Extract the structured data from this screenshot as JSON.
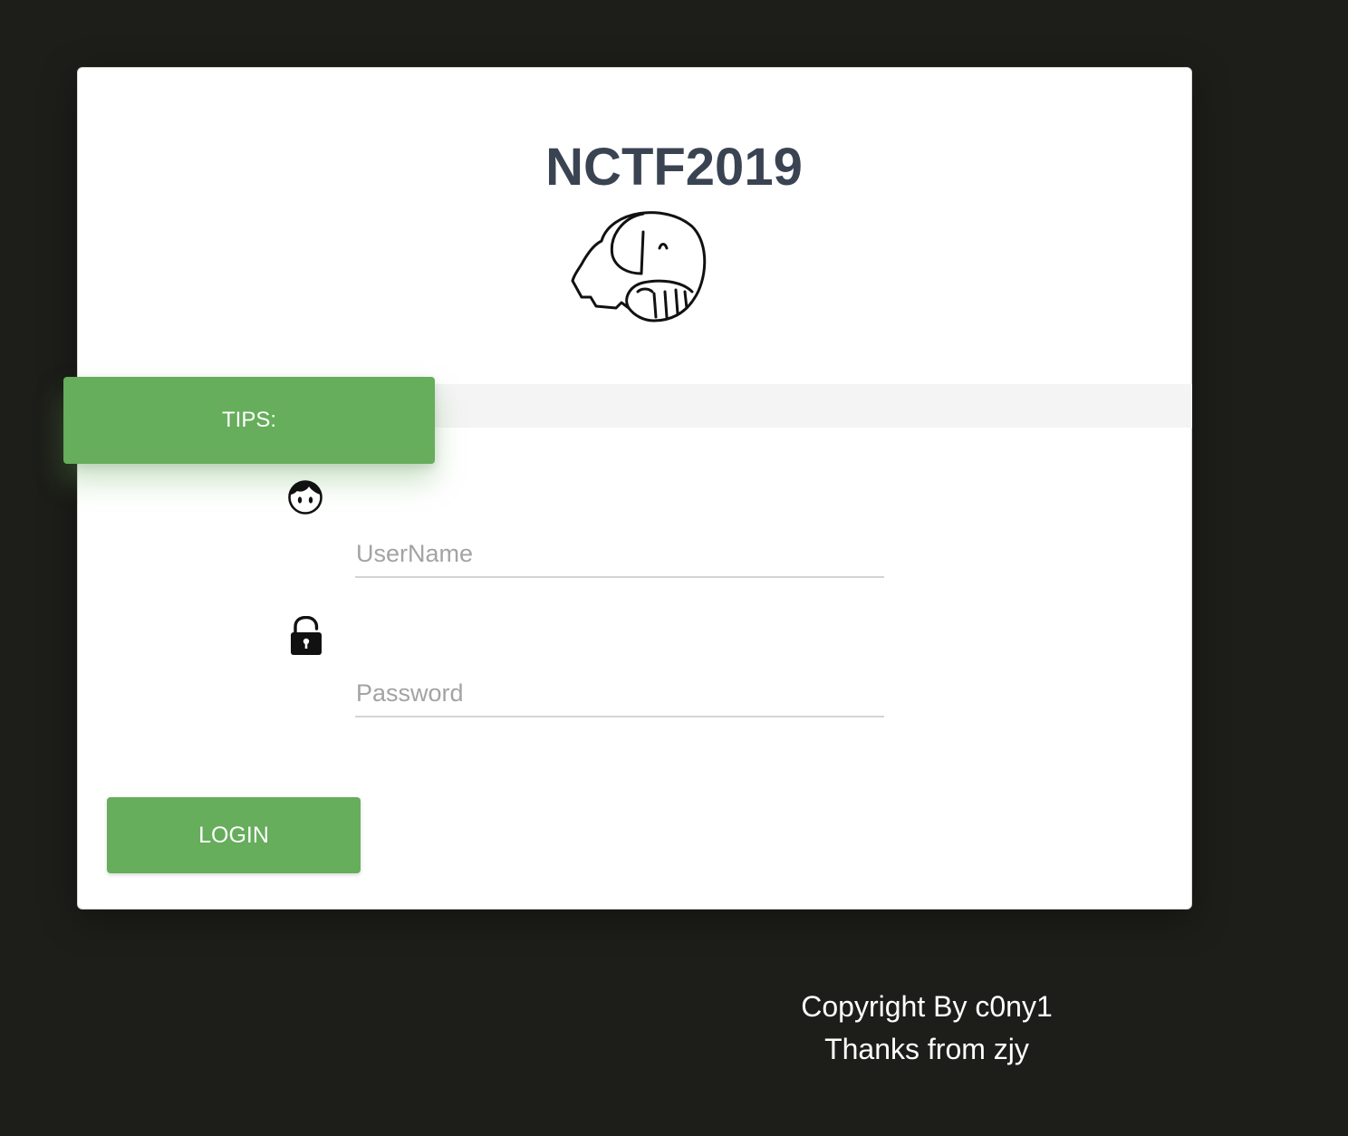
{
  "header": {
    "title": "NCTF2019",
    "logo_icon": "elephant-logo-icon"
  },
  "tips": {
    "label": "TIPS:"
  },
  "form": {
    "username": {
      "icon": "user-face-icon",
      "placeholder": "UserName",
      "value": ""
    },
    "password": {
      "icon": "unlocked-padlock-icon",
      "placeholder": "Password",
      "value": ""
    },
    "login_label": "LOGIN"
  },
  "footer": {
    "copyright": "Copyright By c0ny1",
    "thanks": "Thanks from zjy"
  },
  "colors": {
    "background": "#1d1d19",
    "accent_green": "#66ad5c",
    "title_text": "#3a4352",
    "card": "#ffffff"
  }
}
